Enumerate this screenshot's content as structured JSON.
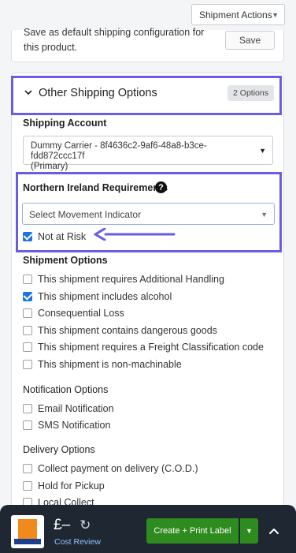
{
  "header": {
    "actions_label": "Shipment Actions",
    "actions_caret": "▼"
  },
  "top_card": {
    "description": "Save as default shipping configuration for this product.",
    "save_label": "Save"
  },
  "section": {
    "title": "Other Shipping Options",
    "badge": "2 Options"
  },
  "shipping_account": {
    "label": "Shipping Account",
    "line1": "Dummy Carrier - 8f4636c2-9af6-48a8-b3ce-fdd872ccc17f",
    "line2": "(Primary)",
    "caret": "▼"
  },
  "ni": {
    "label": "Northern Ireland Requirements",
    "help_glyph": "?",
    "select_placeholder": "Select Movement Indicator",
    "caret": "▼",
    "not_at_risk_label": "Not at Risk",
    "not_at_risk_checked": true
  },
  "shipment_options": {
    "label": "Shipment Options",
    "items": [
      {
        "label": "This shipment requires Additional Handling",
        "checked": false
      },
      {
        "label": "This shipment includes alcohol",
        "checked": true
      },
      {
        "label": "Consequential Loss",
        "checked": false
      },
      {
        "label": "This shipment contains dangerous goods",
        "checked": false
      },
      {
        "label": "This shipment requires a Freight Classification code",
        "checked": false
      },
      {
        "label": "This shipment is non-machinable",
        "checked": false
      }
    ]
  },
  "notification_options": {
    "label": "Notification Options",
    "items": [
      {
        "label": "Email Notification",
        "checked": false
      },
      {
        "label": "SMS Notification",
        "checked": false
      }
    ]
  },
  "delivery_options": {
    "label": "Delivery Options",
    "items": [
      {
        "label": "Collect payment on delivery (C.O.D.)",
        "checked": false
      },
      {
        "label": "Hold for Pickup",
        "checked": false
      },
      {
        "label": "Local Collect",
        "checked": false
      }
    ]
  },
  "footer": {
    "price": "£–",
    "cost_review_label": "Cost Review",
    "print_label": "Create + Print Label",
    "print_caret": "▼"
  },
  "colors": {
    "highlight": "#6a5ce3",
    "primary_button": "#2e8b1e",
    "checkbox_checked": "#1a73e8",
    "footer_bg": "#1f2733"
  }
}
